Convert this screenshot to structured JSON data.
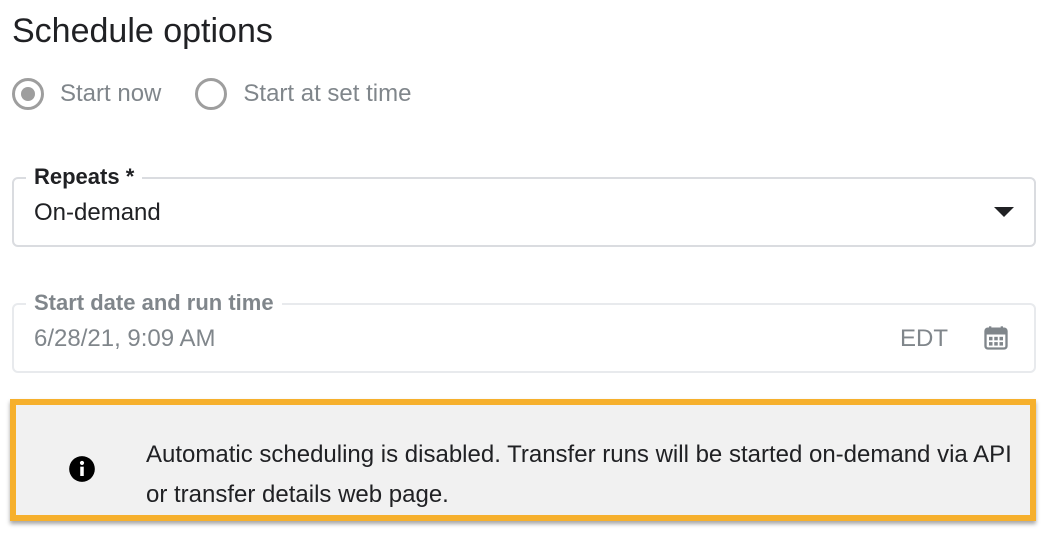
{
  "section": {
    "title": "Schedule options"
  },
  "schedule": {
    "options": [
      {
        "label": "Start now",
        "selected": true
      },
      {
        "label": "Start at set time",
        "selected": false
      }
    ]
  },
  "repeats": {
    "label": "Repeats *",
    "value": "On-demand"
  },
  "start": {
    "label": "Start date and run time",
    "value": "6/28/21, 9:09 AM",
    "timezone": "EDT"
  },
  "notice": {
    "icon": "info-icon",
    "text": "Automatic scheduling is disabled. Transfer runs will be started on-demand via API or transfer details web page."
  },
  "colors": {
    "highlight": "#f6b02d",
    "notice_bg": "#f1f1f1",
    "disabled_text": "#80868b"
  }
}
